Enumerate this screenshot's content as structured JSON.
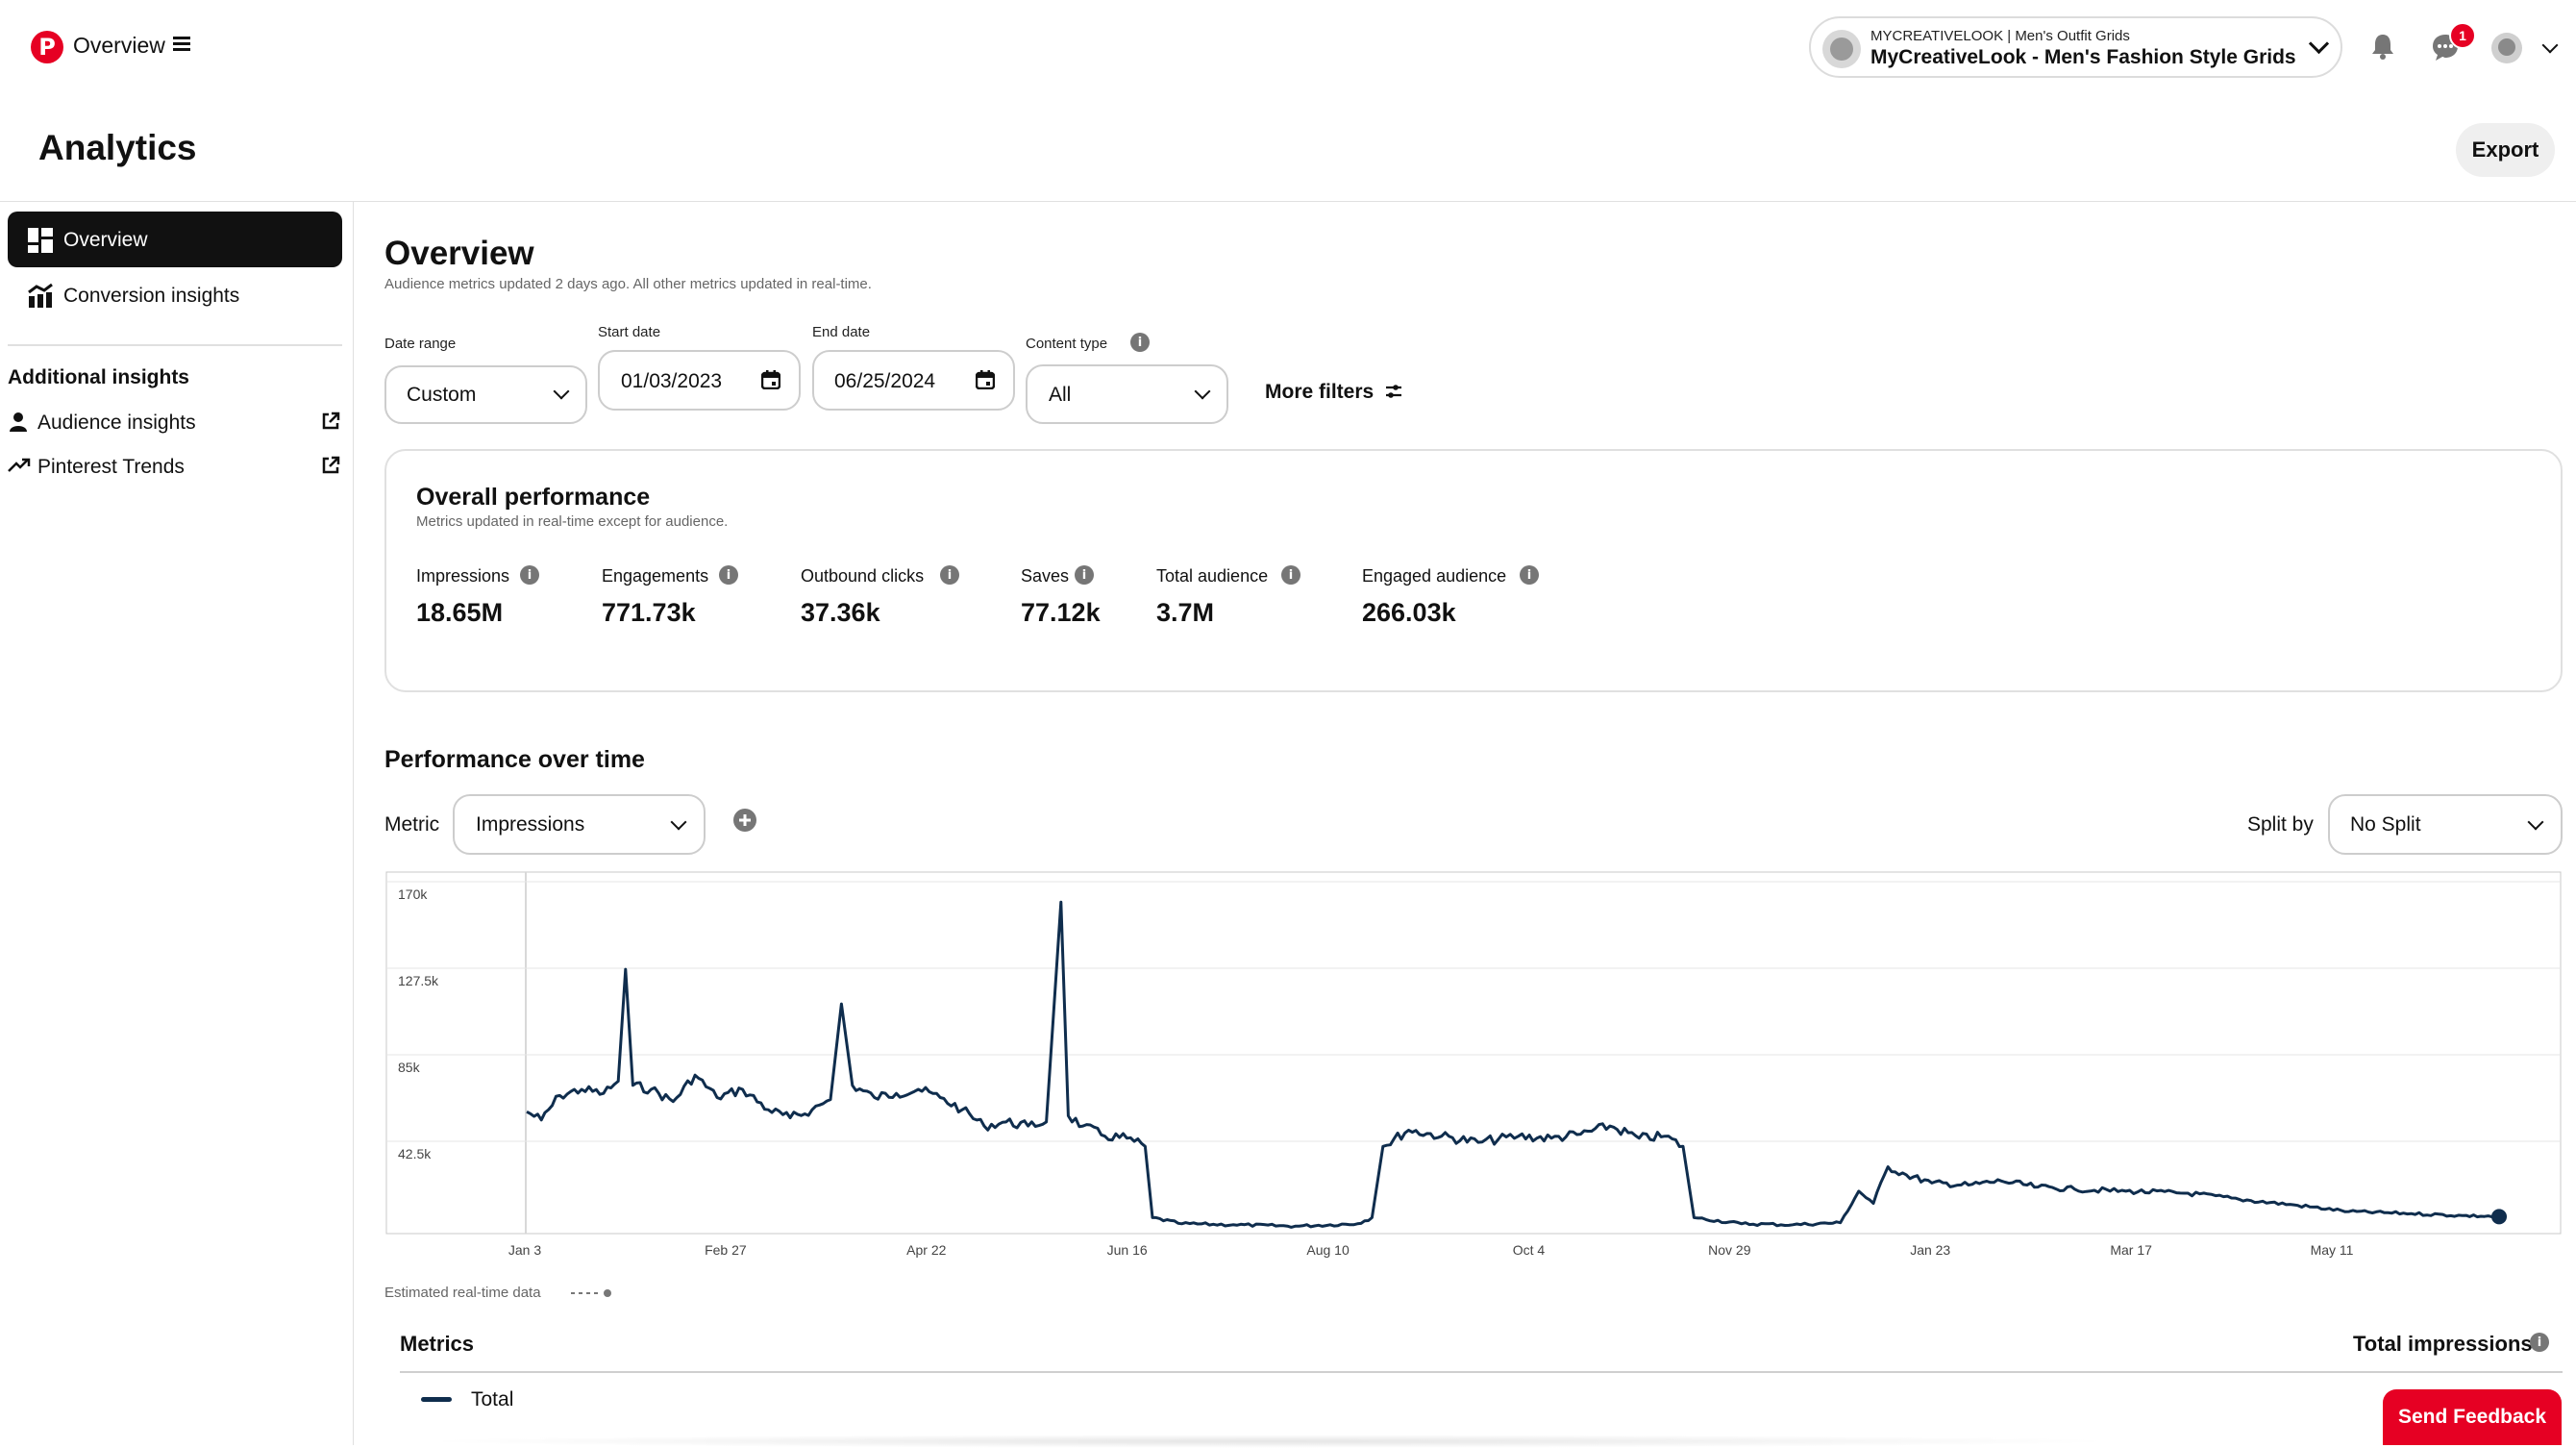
{
  "topbar": {
    "logo_glyph": "P",
    "title": "Overview",
    "account_small": "MYCREATIVELOOK | Men's Outfit Grids",
    "account_name": "MyCreativeLook - Men's Fashion Style Grids",
    "messages_badge": "1"
  },
  "header": {
    "title": "Analytics",
    "export_label": "Export"
  },
  "sidebar": {
    "items": [
      {
        "label": "Overview",
        "icon": "dashboard-icon",
        "active": true
      },
      {
        "label": "Conversion insights",
        "icon": "conversion-chart-icon"
      }
    ],
    "additional_heading": "Additional insights",
    "additional": [
      {
        "label": "Audience insights",
        "icon": "person-icon"
      },
      {
        "label": "Pinterest Trends",
        "icon": "trend-arrow-icon"
      }
    ]
  },
  "overview": {
    "title": "Overview",
    "subtitle": "Audience metrics updated 2 days ago. All other metrics updated in real-time."
  },
  "filters": {
    "date_range_label": "Date range",
    "date_range_value": "Custom",
    "start_label": "Start date",
    "start_value": "01/03/2023",
    "end_label": "End date",
    "end_value": "06/25/2024",
    "content_type_label": "Content type",
    "content_type_value": "All",
    "more_filters": "More filters"
  },
  "performance": {
    "title": "Overall performance",
    "subtitle": "Metrics updated in real-time except for audience.",
    "metrics": [
      {
        "label": "Impressions",
        "value": "18.65M"
      },
      {
        "label": "Engagements",
        "value": "771.73k"
      },
      {
        "label": "Outbound clicks",
        "value": "37.36k"
      },
      {
        "label": "Saves",
        "value": "77.12k"
      },
      {
        "label": "Total audience",
        "value": "3.7M"
      },
      {
        "label": "Engaged audience",
        "value": "266.03k"
      }
    ]
  },
  "over_time": {
    "title": "Performance over time",
    "metric_label": "Metric",
    "metric_value": "Impressions",
    "split_label": "Split by",
    "split_value": "No Split",
    "estimated_note": "Estimated real-time data",
    "metrics_heading": "Metrics",
    "total_impressions_heading": "Total impressions",
    "legend_total": "Total"
  },
  "feedback_label": "Send Feedback",
  "colors": {
    "brand": "#e60023",
    "line": "#0f2d4d",
    "active_nav": "#111111"
  },
  "chart_data": {
    "type": "line",
    "yticks": [
      "170k",
      "127.5k",
      "85k",
      "42.5k"
    ],
    "ytick_values": [
      170000,
      127500,
      85000,
      42500
    ],
    "ylim": [
      0,
      170000
    ],
    "xticks": [
      "Jan 3",
      "Feb 27",
      "Apr 22",
      "Jun 16",
      "Aug 10",
      "Oct 4",
      "Nov 29",
      "Jan 23",
      "Mar 17",
      "May 11"
    ],
    "x_start": "2023-01-03",
    "x_end": "2024-06-25",
    "grid": true,
    "series": [
      {
        "name": "Total",
        "points": [
          [
            "2023-01-03",
            57000
          ],
          [
            "2023-01-07",
            53000
          ],
          [
            "2023-01-12",
            65000
          ],
          [
            "2023-01-18",
            68000
          ],
          [
            "2023-01-24",
            66000
          ],
          [
            "2023-01-28",
            72000
          ],
          [
            "2023-01-30",
            127000
          ],
          [
            "2023-02-01",
            70000
          ],
          [
            "2023-02-06",
            68000
          ],
          [
            "2023-02-12",
            62000
          ],
          [
            "2023-02-18",
            75000
          ],
          [
            "2023-02-24",
            64000
          ],
          [
            "2023-03-03",
            68000
          ],
          [
            "2023-03-10",
            58000
          ],
          [
            "2023-03-16",
            54000
          ],
          [
            "2023-03-22",
            58000
          ],
          [
            "2023-03-27",
            63000
          ],
          [
            "2023-03-30",
            110000
          ],
          [
            "2023-04-02",
            70000
          ],
          [
            "2023-04-08",
            64000
          ],
          [
            "2023-04-14",
            66000
          ],
          [
            "2023-04-20",
            68000
          ],
          [
            "2023-04-26",
            64000
          ],
          [
            "2023-05-02",
            58000
          ],
          [
            "2023-05-08",
            50000
          ],
          [
            "2023-05-14",
            52000
          ],
          [
            "2023-05-20",
            50000
          ],
          [
            "2023-05-25",
            52000
          ],
          [
            "2023-05-29",
            160000
          ],
          [
            "2023-05-31",
            55000
          ],
          [
            "2023-06-04",
            50000
          ],
          [
            "2023-06-10",
            45000
          ],
          [
            "2023-06-16",
            44000
          ],
          [
            "2023-06-21",
            40000
          ],
          [
            "2023-06-23",
            5000
          ],
          [
            "2023-07-01",
            2000
          ],
          [
            "2023-07-15",
            1500
          ],
          [
            "2023-08-01",
            800
          ],
          [
            "2023-08-18",
            2000
          ],
          [
            "2023-08-22",
            5000
          ],
          [
            "2023-08-25",
            40000
          ],
          [
            "2023-09-01",
            48000
          ],
          [
            "2023-09-10",
            45000
          ],
          [
            "2023-09-20",
            42000
          ],
          [
            "2023-10-01",
            45000
          ],
          [
            "2023-10-10",
            44000
          ],
          [
            "2023-10-18",
            46000
          ],
          [
            "2023-10-26",
            50000
          ],
          [
            "2023-11-03",
            44000
          ],
          [
            "2023-11-10",
            45000
          ],
          [
            "2023-11-15",
            40000
          ],
          [
            "2023-11-18",
            5000
          ],
          [
            "2023-12-01",
            2000
          ],
          [
            "2023-12-15",
            1500
          ],
          [
            "2023-12-28",
            2500
          ],
          [
            "2024-01-02",
            18000
          ],
          [
            "2024-01-06",
            12000
          ],
          [
            "2024-01-10",
            30000
          ],
          [
            "2024-01-15",
            26000
          ],
          [
            "2024-01-22",
            22000
          ],
          [
            "2024-02-01",
            21000
          ],
          [
            "2024-02-10",
            23000
          ],
          [
            "2024-02-20",
            20000
          ],
          [
            "2024-03-01",
            19000
          ],
          [
            "2024-03-15",
            18000
          ],
          [
            "2024-04-01",
            17000
          ],
          [
            "2024-04-15",
            14000
          ],
          [
            "2024-05-01",
            11000
          ],
          [
            "2024-05-15",
            8000
          ],
          [
            "2024-06-01",
            7000
          ],
          [
            "2024-06-15",
            6000
          ],
          [
            "2024-06-25",
            5500
          ]
        ]
      }
    ]
  }
}
